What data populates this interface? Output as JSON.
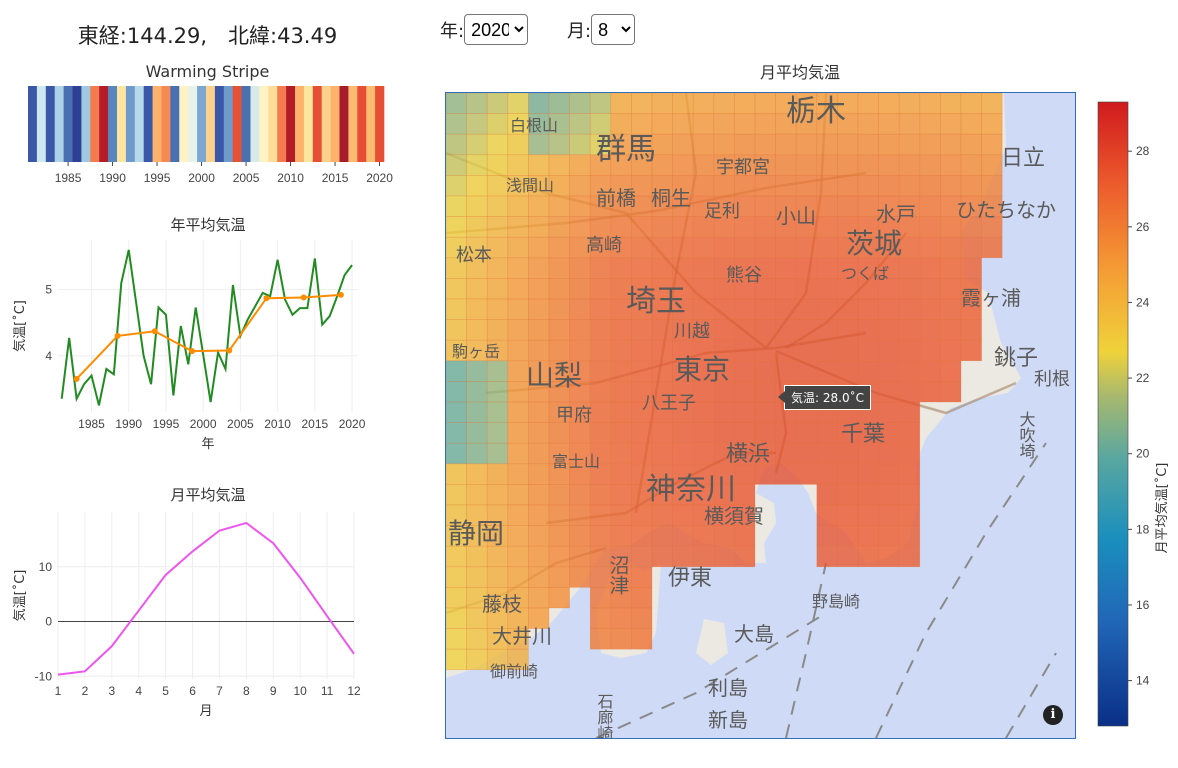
{
  "header": {
    "coordinates": "東経:144.29,　北緯:43.49"
  },
  "controls": {
    "year_label": "年:",
    "year_value": "2020",
    "month_label": "月:",
    "month_value": "8"
  },
  "warming_stripe": {
    "title": "Warming Stripe",
    "years": [
      1981,
      1982,
      1983,
      1984,
      1985,
      1986,
      1987,
      1988,
      1989,
      1990,
      1991,
      1992,
      1993,
      1994,
      1995,
      1996,
      1997,
      1998,
      1999,
      2000,
      2001,
      2002,
      2003,
      2004,
      2005,
      2006,
      2007,
      2008,
      2009,
      2010,
      2011,
      2012,
      2013,
      2014,
      2015,
      2016,
      2017,
      2018,
      2019,
      2020
    ],
    "stripe_colors": [
      "#3b58a8",
      "#cfe7f1",
      "#3b58a8",
      "#abd2e6",
      "#4a70b2",
      "#2f3f95",
      "#9ec9e0",
      "#f27c4d",
      "#b51c2a",
      "#5a86be",
      "#fee6a0",
      "#6f9acb",
      "#b6d8e9",
      "#3b58a8",
      "#fdb36b",
      "#f68a54",
      "#4a70b2",
      "#fff3c4",
      "#e6f2ec",
      "#7ba7d0",
      "#fdd18c",
      "#3b58a8",
      "#6f9acb",
      "#e45136",
      "#4a70b2",
      "#d6ebe9",
      "#fff3c4",
      "#fddd97",
      "#f47a50",
      "#b51c2a",
      "#fdb36b",
      "#fee6a0",
      "#e64f35",
      "#fdd18c",
      "#fdb36b",
      "#a61c2a",
      "#fdbb72",
      "#e64f35",
      "#fdbb72",
      "#e64f35"
    ],
    "tick_labels": [
      "1985",
      "1990",
      "1995",
      "2000",
      "2005",
      "2010",
      "2015",
      "2020"
    ]
  },
  "annual_chart": {
    "title": "年平均気温",
    "xlabel": "年",
    "ylabel": "気温[˚C]"
  },
  "monthly_chart": {
    "title": "月平均気温",
    "xlabel": "月",
    "ylabel": "気温[˚C]"
  },
  "map": {
    "title": "月平均気温",
    "tooltip": "気温: 28.0˚C",
    "info_label": "i",
    "place_labels": [
      "白根山",
      "群馬",
      "宇都宮",
      "栃木",
      "日立",
      "浅間山",
      "前橋",
      "桐生",
      "足利",
      "小山",
      "水戸",
      "ひたちなか",
      "高崎",
      "茨城",
      "熊谷",
      "つくば",
      "松本",
      "霞ヶ浦",
      "埼玉",
      "川越",
      "駒ヶ岳",
      "山梨",
      "東京",
      "銚子",
      "利根",
      "八王子",
      "甲府",
      "大吹埼",
      "富士山",
      "横浜",
      "千葉",
      "神奈川",
      "横須賀",
      "静岡",
      "沼津",
      "伊東",
      "藤枝",
      "大島",
      "野島崎",
      "大井川",
      "御前崎",
      "石廊崎",
      "利島",
      "新島"
    ],
    "colorbar_title": "月平均気温[˚C]"
  },
  "chart_data": [
    {
      "type": "heatmap",
      "title": "Warming Stripe",
      "x": [
        1981,
        1982,
        1983,
        1984,
        1985,
        1986,
        1987,
        1988,
        1989,
        1990,
        1991,
        1992,
        1993,
        1994,
        1995,
        1996,
        1997,
        1998,
        1999,
        2000,
        2001,
        2002,
        2003,
        2004,
        2005,
        2006,
        2007,
        2008,
        2009,
        2010,
        2011,
        2012,
        2013,
        2014,
        2015,
        2016,
        2017,
        2018,
        2019,
        2020
      ],
      "xticks": [
        1985,
        1990,
        1995,
        2000,
        2005,
        2010,
        2015,
        2020
      ]
    },
    {
      "type": "line",
      "title": "年平均気温",
      "xlabel": "年",
      "ylabel": "気温[˚C]",
      "xlim": [
        1980.5,
        2020.8
      ],
      "ylim": [
        3.15,
        5.75
      ],
      "xticks": [
        1985,
        1990,
        1995,
        2000,
        2005,
        2010,
        2015,
        2020
      ],
      "yticks": [
        4,
        5
      ],
      "series": [
        {
          "color": "#228b22",
          "x": [
            1981,
            1982,
            1983,
            1984,
            1985,
            1986,
            1987,
            1988,
            1989,
            1990,
            1991,
            1992,
            1993,
            1994,
            1995,
            1996,
            1997,
            1998,
            1999,
            2000,
            2001,
            2002,
            2003,
            2004,
            2005,
            2006,
            2007,
            2008,
            2009,
            2010,
            2011,
            2012,
            2013,
            2014,
            2015,
            2016,
            2017,
            2018,
            2019,
            2020
          ],
          "values": [
            3.35,
            4.27,
            3.35,
            3.57,
            3.7,
            3.25,
            3.8,
            3.72,
            5.1,
            5.6,
            4.8,
            4.0,
            3.57,
            4.73,
            4.62,
            3.4,
            4.45,
            3.87,
            4.73,
            4.02,
            3.3,
            4.05,
            3.8,
            5.07,
            4.3,
            4.55,
            4.75,
            4.95,
            4.9,
            5.45,
            4.85,
            4.62,
            4.72,
            4.72,
            5.47,
            4.47,
            4.6,
            4.9,
            5.22,
            5.37
          ]
        },
        {
          "color": "#ff8c00",
          "x": [
            1983,
            1988.5,
            1993.5,
            1998.5,
            2003.5,
            2008.5,
            2013.5,
            2018.5
          ],
          "values": [
            3.65,
            4.3,
            4.37,
            4.07,
            4.08,
            4.87,
            4.88,
            4.92
          ]
        }
      ]
    },
    {
      "type": "line",
      "title": "月平均気温",
      "xlabel": "月",
      "ylabel": "気温[˚C]",
      "xlim": [
        1,
        12
      ],
      "ylim": [
        -10.5,
        20
      ],
      "xticks": [
        1,
        2,
        3,
        4,
        5,
        6,
        7,
        8,
        9,
        10,
        11,
        12
      ],
      "yticks": [
        -10,
        0,
        10
      ],
      "series": [
        {
          "color": "#ee55ee",
          "x": [
            1,
            2,
            3,
            4,
            5,
            6,
            7,
            8,
            9,
            10,
            11,
            12
          ],
          "values": [
            -9.7,
            -9.1,
            -4.5,
            2.0,
            8.5,
            12.8,
            16.6,
            18.0,
            14.3,
            8.0,
            1.0,
            -5.9
          ]
        }
      ]
    },
    {
      "type": "heatmap",
      "title": "月平均気温",
      "colorbar_label": "月平均気温[˚C]",
      "zlim": [
        12.8,
        29.3
      ],
      "colorbar_ticks": [
        14,
        16,
        18,
        20,
        22,
        24,
        26,
        28
      ]
    }
  ]
}
